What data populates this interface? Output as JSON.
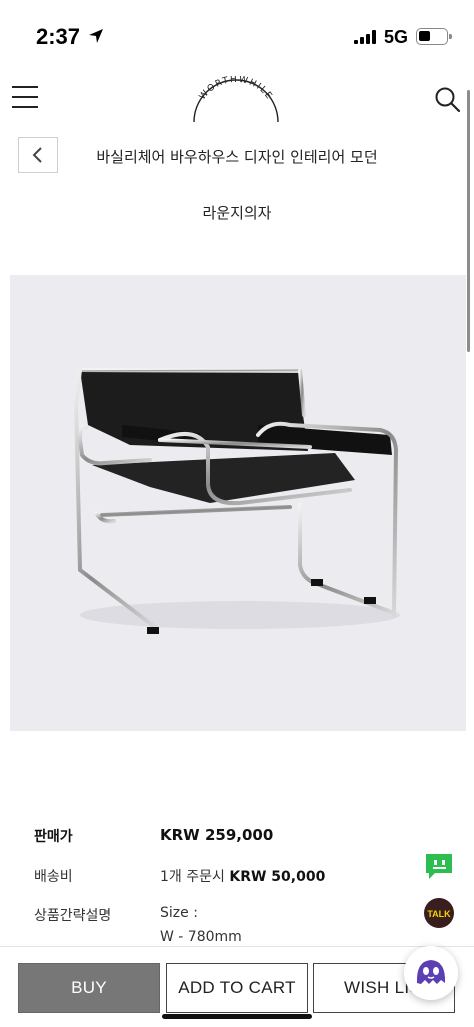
{
  "status_bar": {
    "time": "2:37",
    "network": "5G"
  },
  "header": {
    "logo_text": "WORTHWHILE"
  },
  "product": {
    "title_line1": "바실리체어 바우하우스 디자인 인테리어 모던",
    "title_line2": "라운지의자"
  },
  "info": {
    "price_label": "판매가",
    "price_value": "KRW 259,000",
    "shipping_label": "배송비",
    "shipping_prefix": "1개 주문시",
    "shipping_value": "KRW 50,000",
    "summary_label": "상품간략설명",
    "summary_line1": "Size :",
    "summary_line2": "W - 780mm"
  },
  "bottom_bar": {
    "buy_label": "BUY",
    "cart_label": "ADD TO CART",
    "wish_label": "WISH LIST"
  },
  "icons": {
    "talk_label": "TALK"
  },
  "colors": {
    "buy_bg": "#777777",
    "chat_green": "#2ebd4f",
    "talk_brown": "#3a1d1d"
  }
}
